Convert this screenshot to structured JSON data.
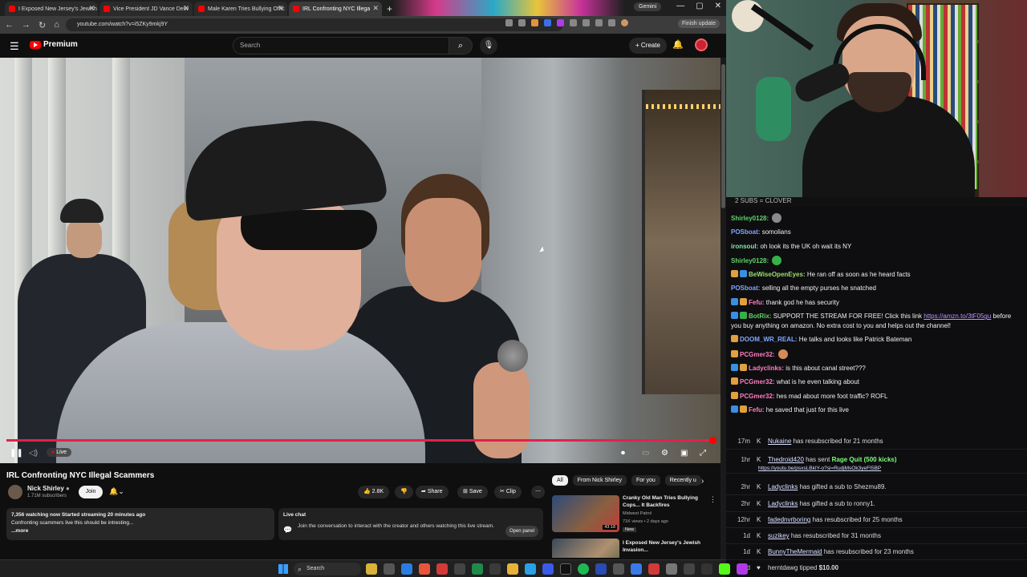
{
  "browser": {
    "tabs": [
      {
        "label": "I Exposed New Jersey's Jewish"
      },
      {
        "label": "Vice President JD Vance Deliv"
      },
      {
        "label": "Male Karen Tries Bullying Offic"
      },
      {
        "label": "IRL Confronting NYC Illega"
      }
    ],
    "gemini": "Gemini",
    "url": "youtube.com/watch?v=i5ZKy9mkj9Y",
    "finish_update": "Finish update"
  },
  "youtube": {
    "logo": "Premium",
    "search_placeholder": "Search",
    "create": "Create",
    "live": "Live",
    "title": "IRL Confronting NYC Illegal Scammers",
    "channel": "Nick Shirley",
    "subscribers": "1.71M subscribers",
    "join": "Join",
    "likes": "2.8K",
    "share": "Share",
    "save": "Save",
    "clip": "Clip",
    "desc_line1": "7,356 watching now  Started streaming 20 minutes ago",
    "desc_line2": "Confronting scammers live this should be intresting...",
    "desc_more": "...more",
    "livechat_title": "Live chat",
    "livechat_text": "Join the conversation to interact with the creator and others watching this live stream.",
    "open_panel": "Open panel",
    "chips": [
      "All",
      "From Nick Shirley",
      "For you",
      "Recently u"
    ],
    "recs": [
      {
        "title": "Cranky Old Man Tries Bullying Cops... It Backfires",
        "channel": "Midwest Patrol",
        "meta": "71K views • 2 days ago",
        "duration": "43:18",
        "badge": "New"
      },
      {
        "title": "I Exposed New Jersey's Jewish Invasion...",
        "channel": "",
        "meta": "",
        "duration": "",
        "badge": ""
      }
    ]
  },
  "stream": {
    "clover": "2 SUBS = CLOVER",
    "chat": [
      {
        "user": "Shirley0128:",
        "color": "#5fd36b",
        "text": "",
        "emote": "#8a8a8a"
      },
      {
        "user": "POSboat:",
        "color": "#7fa7ff",
        "text": "somolians"
      },
      {
        "user": "ironsoul:",
        "color": "#8be0a6",
        "text": "oh look its the UK oh wait its NY"
      },
      {
        "user": "Shirley0128:",
        "color": "#5fd36b",
        "text": "",
        "emote": "#36b14a"
      },
      {
        "user": "BeWiseOpenEyes:",
        "color": "#9be06b",
        "text": "He ran off as soon as he heard facts"
      },
      {
        "user": "POSboat:",
        "color": "#7fa7ff",
        "text": "selling all the empty purses he snatched"
      },
      {
        "user": "Fefu:",
        "color": "#ff7fbf",
        "text": "thank god he has security"
      },
      {
        "user": "BotRix:",
        "color": "#5fd36b",
        "text": "SUPPORT THE STREAM FOR FREE! Click this link ",
        "link": "https://amzn.to/3tF05gu",
        "text2": " before you buy anything on amazon. No extra cost to you and helps out the channel!"
      },
      {
        "user": "DOOM_WR_REAL:",
        "color": "#7fa7ff",
        "text": "He talks and looks like Patrick Bateman"
      },
      {
        "user": "PCGmer32:",
        "color": "#ff7fbf",
        "text": "",
        "emote": "#d68a5a"
      },
      {
        "user": "Ladyclinks:",
        "color": "#ff7fbf",
        "text": "is this about canal street???"
      },
      {
        "user": "PCGmer32:",
        "color": "#ff7fbf",
        "text": "what is he even talking about"
      },
      {
        "user": "PCGmer32:",
        "color": "#ff7fbf",
        "text": "hes mad about more foot traffic? ROFL"
      },
      {
        "user": "Fefu:",
        "color": "#ff7fbf",
        "text": "he saved that just for this live"
      }
    ],
    "events": [
      {
        "time": "17m",
        "name": "Nukaine",
        "text": " has resubscribed for 21 months"
      },
      {
        "time": "1hr",
        "name": "Thedroid420",
        "text": " has sent ",
        "extra": "Rage Quit (500 kicks)",
        "link": "https://youtu.be/psxsLBkIY-o?si=RudjMsOk3yeFI5BP"
      },
      {
        "time": "2hr",
        "name": "Ladyclinks",
        "text": " has gifted a sub to Shezmu89."
      },
      {
        "time": "2hr",
        "name": "Ladyclinks",
        "text": " has gifted a sub to ronny1."
      },
      {
        "time": "12hr",
        "name": "fadednvrboring",
        "text": " has resubscribed for 25 months"
      },
      {
        "time": "1d",
        "name": "suzikey",
        "text": " has resubscribed for 31 months"
      },
      {
        "time": "1d",
        "name": "BunnyTheMermaid",
        "text": " has resubscribed for 23 months"
      },
      {
        "time": "1d",
        "name": "herntdawg",
        "text": " tipped ",
        "extra": "$10.00"
      }
    ]
  },
  "taskbar": {
    "search": "Search"
  },
  "colors": {
    "accent": "#ff0000",
    "progress": "#e0224d",
    "link": "#bf94ff"
  }
}
